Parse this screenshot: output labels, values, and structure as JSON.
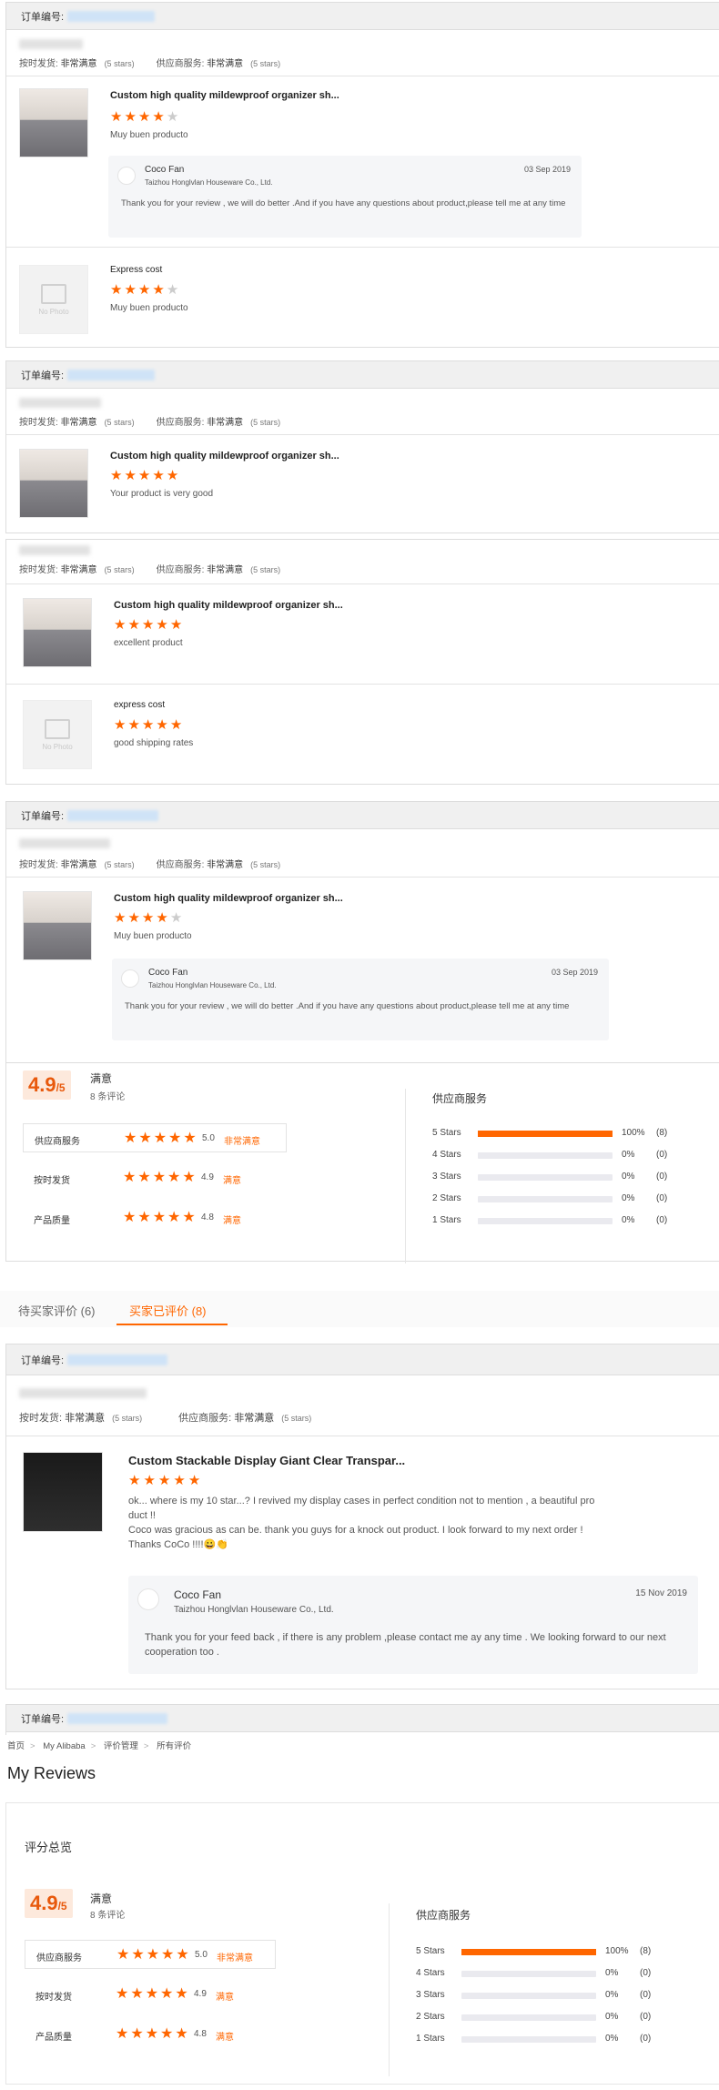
{
  "common": {
    "order_label": "订单编号:",
    "ontime_label": "按时发货:",
    "supplier_label": "供应商服务:",
    "rating_very_satisfied": "非常满意",
    "five_stars_text": "(5 stars)",
    "no_photo": "No Photo"
  },
  "blocks": {
    "b1": {
      "product1": {
        "title": "Custom high quality mildewproof organizer sh...",
        "rating": 4,
        "text": "Muy buen producto"
      },
      "reply": {
        "name": "Coco Fan",
        "company": "Taizhou Honglvlan Houseware Co., Ltd.",
        "date": "03 Sep 2019",
        "text": "Thank you for your review , we will do better .And if you have any questions about product,please tell me at any time"
      },
      "product2": {
        "title": "Express cost",
        "rating": 4,
        "text": "Muy buen producto"
      }
    },
    "b2": {
      "product1": {
        "title": "Custom high quality mildewproof organizer sh...",
        "rating": 5,
        "text": "Your product is very good"
      }
    },
    "b3": {
      "product1": {
        "title": "Custom high quality mildewproof organizer sh...",
        "rating": 5,
        "text": "excellent product"
      },
      "product2": {
        "title": "express cost",
        "rating": 5,
        "text": "good shipping rates"
      }
    },
    "b4": {
      "product1": {
        "title": "Custom high quality mildewproof organizer sh...",
        "rating": 4,
        "text": "Muy buen producto"
      },
      "reply": {
        "name": "Coco Fan",
        "company": "Taizhou Honglvlan Houseware Co., Ltd.",
        "date": "03 Sep 2019",
        "text": "Thank you for your review , we will do better .And if you have any questions about product,please tell me at any time"
      }
    },
    "b5": {
      "product1": {
        "title": "Custom Stackable Display Giant Clear Transpar...",
        "rating": 5,
        "text1": "ok... where is my 10 star...? I revived my display cases  in perfect condition not to mention , a beautiful pro",
        "text2": "duct !!",
        "text3": "Coco was gracious as can be. thank you guys for a knock out product. I look forward to my next order !",
        "text4": "Thanks CoCo !!!!😀👏"
      },
      "reply": {
        "name": "Coco Fan",
        "company": "Taizhou Honglvlan Houseware Co., Ltd.",
        "date": "15 Nov 2019",
        "text": "Thank you for your feed back , if there is any problem ,please contact me ay any time . We looking forward to our next cooperation too ."
      }
    }
  },
  "summary": {
    "score": "4.9",
    "score_suffix": "/5",
    "satisfaction": "满意",
    "review_count": "8 条评论",
    "overview_title": "评分总览",
    "metrics": [
      {
        "label": "供应商服务",
        "value": "5.0",
        "quality": "非常满意",
        "stars": 5
      },
      {
        "label": "按时发货",
        "value": "4.9",
        "quality": "满意",
        "stars": 5
      },
      {
        "label": "产品质量",
        "value": "4.8",
        "quality": "满意",
        "stars": 5
      }
    ],
    "dist_title": "供应商服务",
    "distribution": [
      {
        "label": "5 Stars",
        "percent": "100%",
        "count": "(8)",
        "fraction": 1.0
      },
      {
        "label": "4 Stars",
        "percent": "0%",
        "count": "(0)",
        "fraction": 0
      },
      {
        "label": "3 Stars",
        "percent": "0%",
        "count": "(0)",
        "fraction": 0
      },
      {
        "label": "2 Stars",
        "percent": "0%",
        "count": "(0)",
        "fraction": 0
      },
      {
        "label": "1 Stars",
        "percent": "0%",
        "count": "(0)",
        "fraction": 0
      }
    ]
  },
  "tabs": {
    "pending": "待买家评价 (6)",
    "reviewed": "买家已评价 (8)"
  },
  "breadcrumb": [
    "首页",
    "My Alibaba",
    "评价管理",
    "所有评价"
  ],
  "page_title": "My Reviews",
  "colors": {
    "accent": "#ff6600",
    "score_bg": "#fde9dc"
  }
}
